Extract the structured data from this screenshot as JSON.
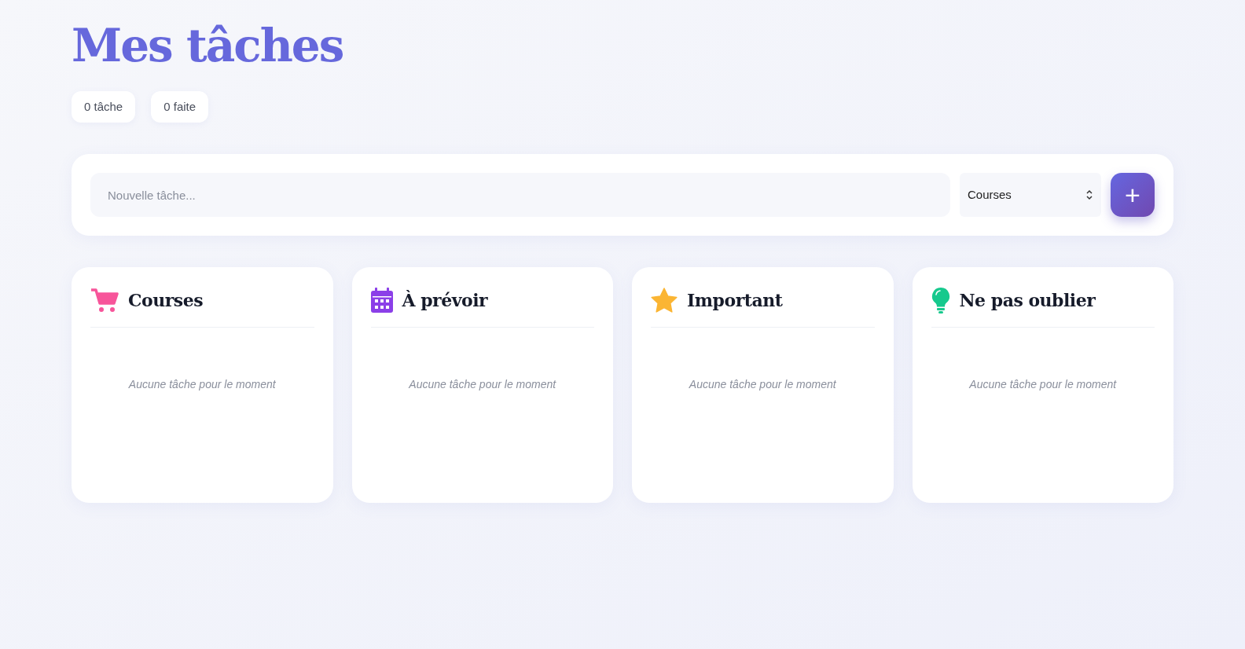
{
  "title": "Mes tâches",
  "stats": [
    "0 tâche",
    "0 faite"
  ],
  "new_task": {
    "placeholder": "Nouvelle tâche...",
    "category": "Courses"
  },
  "add_button": "+",
  "columns": [
    {
      "kind": "cart",
      "title": "Courses",
      "empty": "Aucune tâche pour le moment"
    },
    {
      "kind": "calendar",
      "title": "À prévoir",
      "empty": "Aucune tâche pour le moment"
    },
    {
      "kind": "star",
      "title": "Important",
      "empty": "Aucune tâche pour le moment"
    },
    {
      "kind": "bulb",
      "title": "Ne pas oublier",
      "empty": "Aucune tâche pour le moment"
    }
  ]
}
